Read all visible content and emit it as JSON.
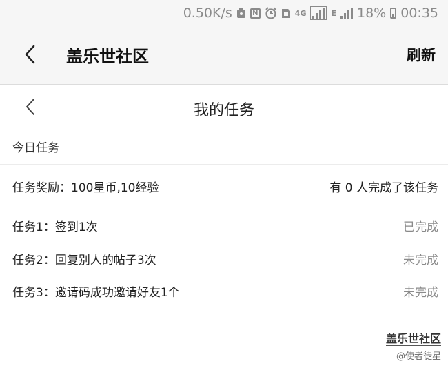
{
  "status_bar": {
    "speed": "0.50K/s",
    "network_4g": "4G",
    "network_e": "E",
    "battery": "18%",
    "time": "00:35",
    "icons": [
      "usb-icon",
      "nfc-icon",
      "alarm-icon",
      "n-icon",
      "signal-icon",
      "battery-icon"
    ]
  },
  "app_bar": {
    "title": "盖乐世社区",
    "refresh_label": "刷新"
  },
  "page": {
    "title": "我的任务",
    "section_header": "今日任务"
  },
  "reward": {
    "label": "任务奖励：100星币,10经验",
    "completed_count_text": "有 0 人完成了该任务"
  },
  "tasks": [
    {
      "label": "任务1：签到1次",
      "status": "已完成"
    },
    {
      "label": "任务2：回复别人的帖子3次",
      "status": "未完成"
    },
    {
      "label": "任务3：邀请码成功邀请好友1个",
      "status": "未完成"
    }
  ],
  "footer": {
    "brand": "盖乐世社区",
    "user": "@使者徒星"
  }
}
